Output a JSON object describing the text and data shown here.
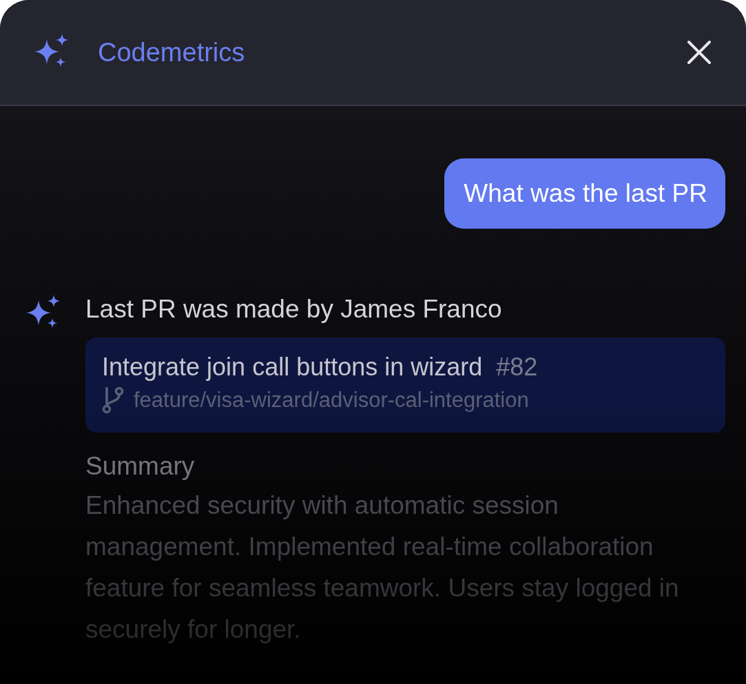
{
  "header": {
    "title": "Codemetrics"
  },
  "messages": [
    {
      "kind": "user",
      "text": "What was the last PR"
    },
    {
      "kind": "assistant",
      "text": "Last PR was made by James Franco",
      "pr": {
        "title": "Integrate join call buttons in wizard",
        "number": "#82",
        "branch": "feature/visa-wizard/advisor-cal-integration"
      },
      "summary_heading": "Summary",
      "summary": "Enhanced security with automatic session management. Implemented real-time collaboration feature for seamless teamwork. Users stay logged in securely for longer."
    }
  ]
}
